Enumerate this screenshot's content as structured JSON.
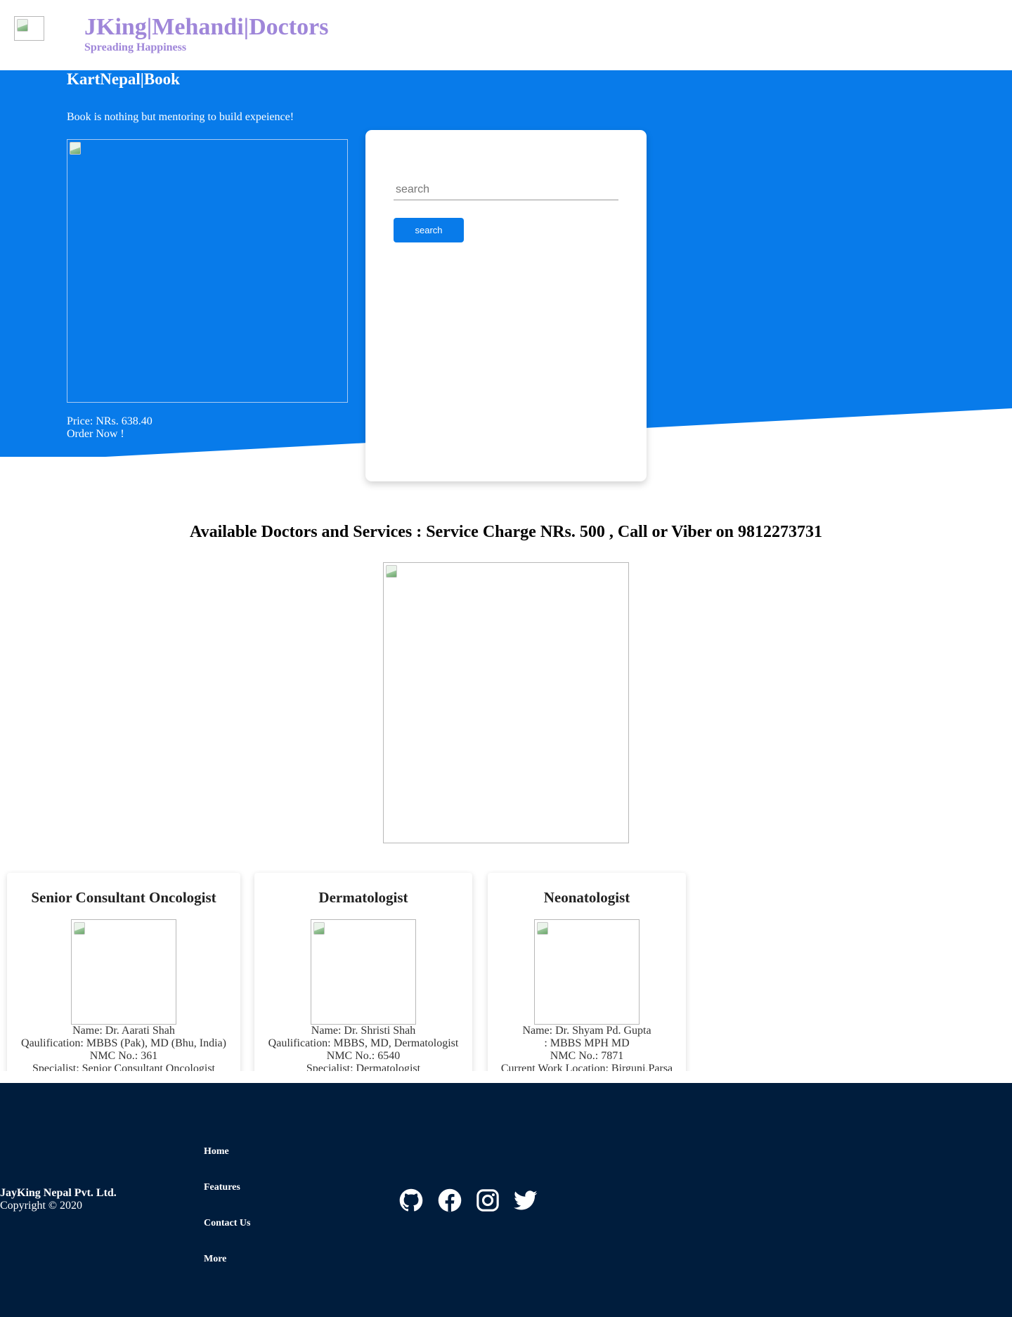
{
  "header": {
    "title": "JKing|Mehandi|Doctors",
    "tagline": "Spreading Happiness",
    "title_color": "#9f86d9"
  },
  "hero": {
    "title": "KartNepal|Book",
    "text": "Book is nothing but mentoring to build expeience!",
    "price": "Price: NRs. 638.40",
    "order": "Order Now !",
    "background_color": "#087bea"
  },
  "search": {
    "placeholder": "search",
    "button_label": "search"
  },
  "doctors": {
    "heading": "Available Doctors and Services : Service Charge NRs. 500 , Call or Viber on 9812273731",
    "cards": [
      {
        "title": "Senior Consultant Oncologist",
        "lines": [
          "Name: Dr. Aarati Shah",
          "Qaulification: MBBS (Pak), MD (Bhu, India)",
          "NMC No.: 361",
          "Specialist: Senior Consultant Oncologist"
        ]
      },
      {
        "title": "Dermatologist",
        "lines": [
          "Name: Dr. Shristi Shah",
          "Qaulification: MBBS, MD, Dermatologist",
          "NMC No.: 6540",
          "Specialist: Dermatologist"
        ]
      },
      {
        "title": "Neonatologist",
        "lines": [
          "Name: Dr. Shyam Pd. Gupta",
          ": MBBS MPH MD",
          "NMC No.: 7871",
          "Current Work Location: Birguni,Parsa"
        ]
      }
    ]
  },
  "footer": {
    "company": "JayKing Nepal Pvt. Ltd.",
    "copyright": "Copyright © 2020",
    "links": [
      "Home",
      "Features",
      "Contact Us",
      "More"
    ],
    "social_icons": [
      "github-icon",
      "facebook-icon",
      "instagram-icon",
      "twitter-icon"
    ],
    "background_color": "#001d3d"
  }
}
